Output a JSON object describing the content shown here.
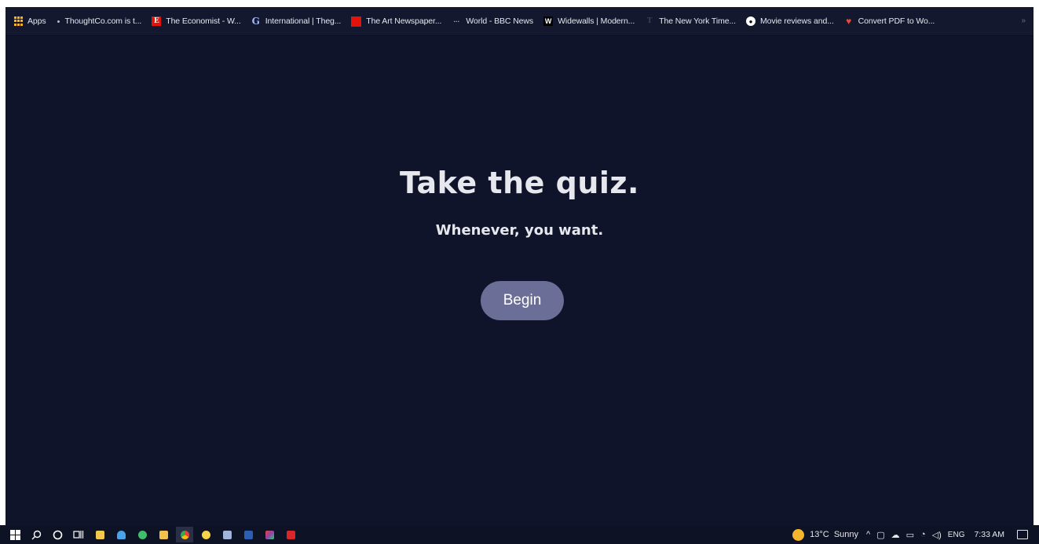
{
  "bookmarks": [
    {
      "label": "Apps",
      "icon": "apps-grid-icon"
    },
    {
      "label": "ThoughtCo.com is t...",
      "icon": "thoughtco-icon"
    },
    {
      "label": "The Economist - W...",
      "icon": "economist-icon",
      "glyph": "E"
    },
    {
      "label": "International | Theg...",
      "icon": "guardian-icon",
      "glyph": "G"
    },
    {
      "label": "The Art Newspaper...",
      "icon": "art-newspaper-icon"
    },
    {
      "label": "World - BBC News",
      "icon": "bbc-icon",
      "glyph": "···"
    },
    {
      "label": "Widewalls | Modern...",
      "icon": "widewalls-icon",
      "glyph": "W"
    },
    {
      "label": "The New York Time...",
      "icon": "nyt-icon",
      "glyph": "T"
    },
    {
      "label": "Movie reviews and...",
      "icon": "movie-reviews-icon",
      "glyph": "●"
    },
    {
      "label": "Convert PDF to Wo...",
      "icon": "pdf-convert-icon",
      "glyph": "♥"
    }
  ],
  "bookmarks_more": "»",
  "hero": {
    "title": "Take the quiz.",
    "subtitle": "Whenever, you want.",
    "begin_label": "Begin"
  },
  "taskbar": {
    "weather": "13°C  Sunny",
    "chevron": "^",
    "language": "ENG",
    "time": "7:33 AM"
  },
  "colors": {
    "background": "#10142a",
    "button": "#6b6f98",
    "text": "#e7e8ee",
    "apps_accent": "#f0b43a",
    "economist_red": "#e3120b"
  }
}
